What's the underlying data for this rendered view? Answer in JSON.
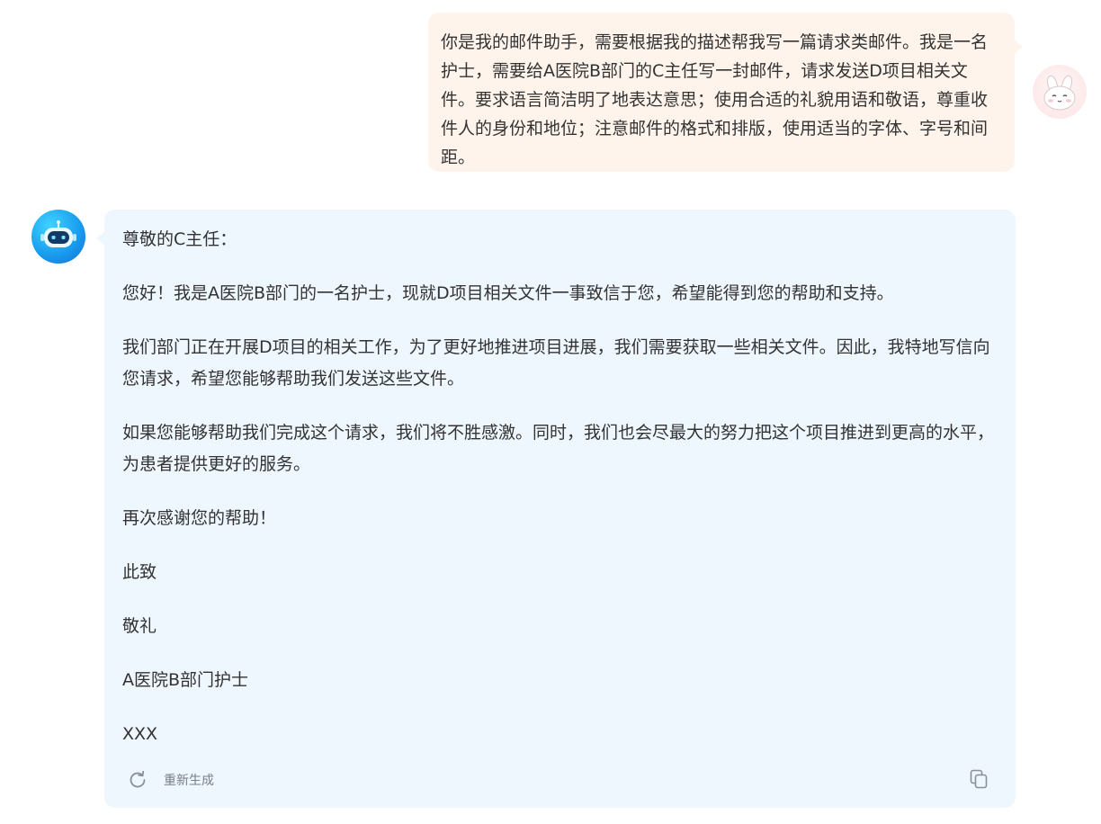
{
  "user_message": {
    "text": "你是我的邮件助手，需要根据我的描述帮我写一篇请求类邮件。我是一名护士，需要给A医院B部门的C主任写一封邮件，请求发送D项目相关文件。要求语言简洁明了地表达意思；使用合适的礼貌用语和敬语，尊重收件人的身份和地位；注意邮件的格式和排版，使用适当的字体、字号和间距。",
    "avatar_icon": "bunny-avatar-icon"
  },
  "bot_message": {
    "avatar_icon": "robot-avatar-icon",
    "paragraphs": [
      "尊敬的C主任：",
      "您好！我是A医院B部门的一名护士，现就D项目相关文件一事致信于您，希望能得到您的帮助和支持。",
      "我们部门正在开展D项目的相关工作，为了更好地推进项目进展，我们需要获取一些相关文件。因此，我特地写信向您请求，希望您能够帮助我们发送这些文件。",
      "如果您能够帮助我们完成这个请求，我们将不胜感激。同时，我们也会尽最大的努力把这个项目推进到更高的水平，为患者提供更好的服务。",
      "再次感谢您的帮助！",
      "此致",
      "敬礼",
      "A医院B部门护士",
      "XXX"
    ],
    "actions": {
      "regenerate_label": "重新生成",
      "regenerate_icon": "refresh-icon",
      "copy_icon": "copy-icon"
    }
  },
  "colors": {
    "user_bubble": "#fff4ec",
    "bot_bubble": "#eef6fe",
    "text": "#333333",
    "muted": "#7a7f86",
    "bot_avatar": "#1a9ef0"
  }
}
